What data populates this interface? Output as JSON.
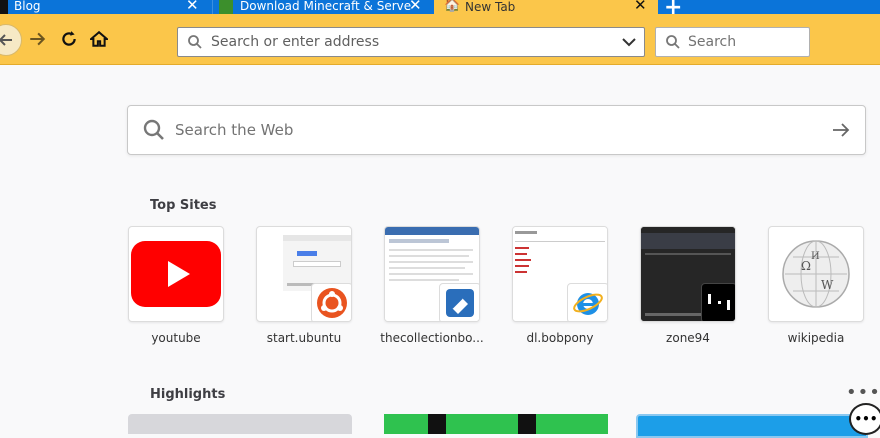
{
  "tabs": [
    {
      "label": "Blog"
    },
    {
      "label": "Download Minecraft & Serve"
    },
    {
      "label": "New Tab"
    }
  ],
  "toolbar": {
    "address_placeholder": "Search or enter address",
    "search_placeholder": "Search"
  },
  "newtab": {
    "web_search_placeholder": "Search the Web",
    "top_sites_title": "Top Sites",
    "highlights_title": "Highlights",
    "top_sites": [
      {
        "label": "youtube"
      },
      {
        "label": "start.ubuntu"
      },
      {
        "label": "thecollectionbo..."
      },
      {
        "label": "dl.bobpony"
      },
      {
        "label": "zone94"
      },
      {
        "label": "wikipedia"
      }
    ],
    "menu_dots": "•••"
  },
  "colors": {
    "tabstrip": "#0b74d9",
    "toolbar": "#fbc64a",
    "youtube_red": "#ff0000"
  }
}
